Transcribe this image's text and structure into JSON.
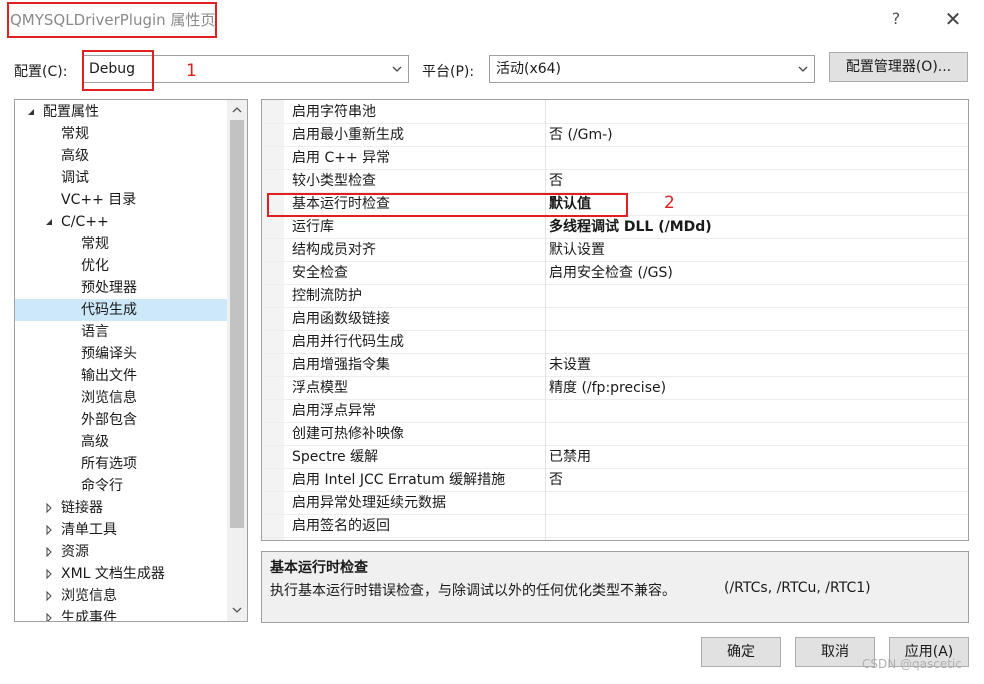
{
  "window": {
    "title": "QMYSQLDriverPlugin 属性页",
    "help": "?",
    "close": "✕"
  },
  "config": {
    "config_label": "配置(C):",
    "config_value": "Debug",
    "platform_label": "平台(P):",
    "platform_value": "活动(x64)",
    "manager_button": "配置管理器(O)..."
  },
  "annotations": {
    "one": "1",
    "two": "2",
    "color": "#e02020"
  },
  "tree": {
    "items": [
      {
        "label": "配置属性",
        "expander": "expanded",
        "level": 0
      },
      {
        "label": "常规",
        "expander": "none",
        "level": 1
      },
      {
        "label": "高级",
        "expander": "none",
        "level": 1
      },
      {
        "label": "调试",
        "expander": "none",
        "level": 1
      },
      {
        "label": "VC++ 目录",
        "expander": "none",
        "level": 1
      },
      {
        "label": "C/C++",
        "expander": "expanded",
        "level": 1
      },
      {
        "label": "常规",
        "expander": "none",
        "level": 2
      },
      {
        "label": "优化",
        "expander": "none",
        "level": 2
      },
      {
        "label": "预处理器",
        "expander": "none",
        "level": 2
      },
      {
        "label": "代码生成",
        "expander": "none",
        "level": 2,
        "selected": true
      },
      {
        "label": "语言",
        "expander": "none",
        "level": 2
      },
      {
        "label": "预编译头",
        "expander": "none",
        "level": 2
      },
      {
        "label": "输出文件",
        "expander": "none",
        "level": 2
      },
      {
        "label": "浏览信息",
        "expander": "none",
        "level": 2
      },
      {
        "label": "外部包含",
        "expander": "none",
        "level": 2
      },
      {
        "label": "高级",
        "expander": "none",
        "level": 2
      },
      {
        "label": "所有选项",
        "expander": "none",
        "level": 2
      },
      {
        "label": "命令行",
        "expander": "none",
        "level": 2
      },
      {
        "label": "链接器",
        "expander": "collapsed",
        "level": 1
      },
      {
        "label": "清单工具",
        "expander": "collapsed",
        "level": 1
      },
      {
        "label": "资源",
        "expander": "collapsed",
        "level": 1
      },
      {
        "label": "XML 文档生成器",
        "expander": "collapsed",
        "level": 1
      },
      {
        "label": "浏览信息",
        "expander": "collapsed",
        "level": 1
      },
      {
        "label": "生成事件",
        "expander": "collapsed",
        "level": 1
      }
    ]
  },
  "grid": {
    "rows": [
      {
        "name": "启用字符串池",
        "value": "",
        "bold": false
      },
      {
        "name": "启用最小重新生成",
        "value": "否 (/Gm-)",
        "bold": false
      },
      {
        "name": "启用 C++ 异常",
        "value": "",
        "bold": false
      },
      {
        "name": "较小类型检查",
        "value": "否",
        "bold": false
      },
      {
        "name": "基本运行时检查",
        "value": "默认值",
        "bold": true
      },
      {
        "name": "运行库",
        "value": "多线程调试 DLL (/MDd)",
        "bold": true
      },
      {
        "name": "结构成员对齐",
        "value": "默认设置",
        "bold": false
      },
      {
        "name": "安全检查",
        "value": "启用安全检查 (/GS)",
        "bold": false
      },
      {
        "name": "控制流防护",
        "value": "",
        "bold": false
      },
      {
        "name": "启用函数级链接",
        "value": "",
        "bold": false
      },
      {
        "name": "启用并行代码生成",
        "value": "",
        "bold": false
      },
      {
        "name": "启用增强指令集",
        "value": "未设置",
        "bold": false
      },
      {
        "name": "浮点模型",
        "value": "精度 (/fp:precise)",
        "bold": false
      },
      {
        "name": "启用浮点异常",
        "value": "",
        "bold": false
      },
      {
        "name": "创建可热修补映像",
        "value": "",
        "bold": false
      },
      {
        "name": "Spectre 缓解",
        "value": "已禁用",
        "bold": false
      },
      {
        "name": "启用 Intel JCC Erratum 缓解措施",
        "value": "否",
        "bold": false
      },
      {
        "name": "启用异常处理延续元数据",
        "value": "",
        "bold": false
      },
      {
        "name": "启用签名的返回",
        "value": "",
        "bold": false
      }
    ]
  },
  "description": {
    "title": "基本运行时检查",
    "text": "执行基本运行时错误检查，与除调试以外的任何优化类型不兼容。",
    "codes": "(/RTCs, /RTCu, /RTC1)"
  },
  "buttons": {
    "ok": "确定",
    "cancel": "取消",
    "apply": "应用(A)"
  },
  "watermark": "CSDN @qascetic"
}
